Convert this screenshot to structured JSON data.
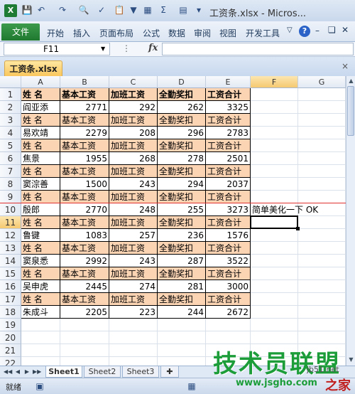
{
  "window": {
    "title": "工资条.xlsx - Micros...",
    "app_icon": "X"
  },
  "ribbon": {
    "file_tab": "文件",
    "tabs": [
      "开始",
      "插入",
      "页面布局",
      "公式",
      "数据",
      "审阅",
      "视图",
      "开发工具"
    ]
  },
  "formula_bar": {
    "name_box": "F11",
    "fx_label": "fx",
    "value": ""
  },
  "workbook_tab": "工资条.xlsx",
  "columns": [
    "A",
    "B",
    "C",
    "D",
    "E",
    "F",
    "G"
  ],
  "selected_cell": {
    "row": 11,
    "col": "F"
  },
  "rows": [
    {
      "n": 1,
      "type": "hdr_bold",
      "cells": [
        "姓 名",
        "基本工资",
        "加班工资",
        "全勤奖扣",
        "工资合计"
      ]
    },
    {
      "n": 2,
      "type": "data",
      "cells": [
        "阎亚添",
        "2771",
        "292",
        "262",
        "3325"
      ]
    },
    {
      "n": 3,
      "type": "hdr",
      "cells": [
        "姓 名",
        "基本工资",
        "加班工资",
        "全勤奖扣",
        "工资合计"
      ]
    },
    {
      "n": 4,
      "type": "data",
      "cells": [
        "易欢靖",
        "2279",
        "208",
        "296",
        "2783"
      ]
    },
    {
      "n": 5,
      "type": "hdr",
      "cells": [
        "姓 名",
        "基本工资",
        "加班工资",
        "全勤奖扣",
        "工资合计"
      ]
    },
    {
      "n": 6,
      "type": "data",
      "cells": [
        "焦景",
        "1955",
        "268",
        "278",
        "2501"
      ]
    },
    {
      "n": 7,
      "type": "hdr",
      "cells": [
        "姓 名",
        "基本工资",
        "加班工资",
        "全勤奖扣",
        "工资合计"
      ]
    },
    {
      "n": 8,
      "type": "data",
      "cells": [
        "窦淙善",
        "1500",
        "243",
        "294",
        "2037"
      ]
    },
    {
      "n": 9,
      "type": "hdr",
      "cells": [
        "姓 名",
        "基本工资",
        "加班工资",
        "全勤奖扣",
        "工资合计"
      ]
    },
    {
      "n": 10,
      "type": "data",
      "cells": [
        "殷郎",
        "2770",
        "248",
        "255",
        "3273"
      ],
      "note": "简单美化一下 OK"
    },
    {
      "n": 11,
      "type": "hdr",
      "cells": [
        "姓 名",
        "基本工资",
        "加班工资",
        "全勤奖扣",
        "工资合计"
      ]
    },
    {
      "n": 12,
      "type": "data",
      "cells": [
        "鲁键",
        "1083",
        "257",
        "236",
        "1576"
      ]
    },
    {
      "n": 13,
      "type": "hdr",
      "cells": [
        "姓 名",
        "基本工资",
        "加班工资",
        "全勤奖扣",
        "工资合计"
      ]
    },
    {
      "n": 14,
      "type": "data",
      "cells": [
        "窦泉悉",
        "2992",
        "243",
        "287",
        "3522"
      ]
    },
    {
      "n": 15,
      "type": "hdr",
      "cells": [
        "姓 名",
        "基本工资",
        "加班工资",
        "全勤奖扣",
        "工资合计"
      ]
    },
    {
      "n": 16,
      "type": "data",
      "cells": [
        "吴申虎",
        "2445",
        "274",
        "281",
        "3000"
      ]
    },
    {
      "n": 17,
      "type": "hdr",
      "cells": [
        "姓 名",
        "基本工资",
        "加班工资",
        "全勤奖扣",
        "工资合计"
      ]
    },
    {
      "n": 18,
      "type": "data",
      "cells": [
        "朱成斗",
        "2205",
        "223",
        "244",
        "2672"
      ]
    },
    {
      "n": 19,
      "type": "empty",
      "cells": []
    },
    {
      "n": 20,
      "type": "empty",
      "cells": []
    },
    {
      "n": 21,
      "type": "empty",
      "cells": []
    },
    {
      "n": 22,
      "type": "empty",
      "cells": []
    }
  ],
  "sheets": [
    "Sheet1",
    "Sheet2",
    "Sheet3"
  ],
  "active_sheet": "Sheet1",
  "status": "就绪",
  "watermark": {
    "main": "技术员联盟",
    "url": "www.jsgho.com",
    "url_small": "jb51.net",
    "tail": "之家"
  },
  "colors": {
    "header_fill": "#fbd4b4",
    "file_tab": "#1f7a30",
    "watermark": "#1c9d3a",
    "red_line": "#e03030"
  }
}
